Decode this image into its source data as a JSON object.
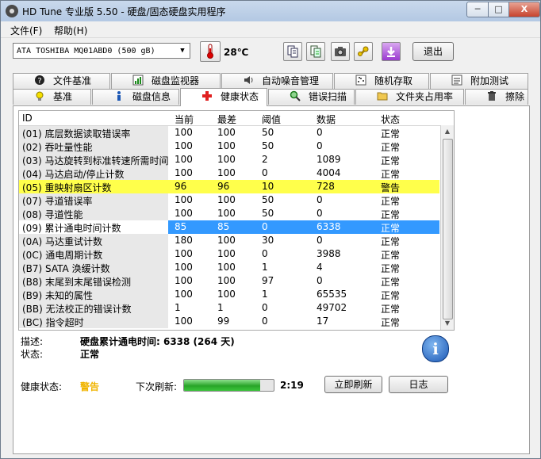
{
  "window": {
    "title": "HD Tune 专业版 5.50 - 硬盘/固态硬盘实用程序",
    "min_glyph": "─",
    "max_glyph": "□",
    "close_glyph": "X"
  },
  "menu": [
    {
      "label": "文件(F)"
    },
    {
      "label": "帮助(H)"
    }
  ],
  "toolbar": {
    "drive": "ATA    TOSHIBA MQ01ABD0 (500 gB)",
    "temperature": "28℃",
    "exit_label": "退出",
    "icons": [
      "copy-icon",
      "copy-info-icon",
      "camera-icon",
      "settings-icon",
      "download-icon"
    ]
  },
  "tabs_top": [
    {
      "label": "文件基准",
      "icon": "file-benchmark-icon"
    },
    {
      "label": "磁盘监视器",
      "icon": "disk-monitor-icon"
    },
    {
      "label": "自动噪音管理",
      "icon": "speaker-icon"
    },
    {
      "label": "随机存取",
      "icon": "random-access-icon"
    },
    {
      "label": "附加测试",
      "icon": "extra-tests-icon"
    }
  ],
  "tabs_bottom": [
    {
      "label": "基准",
      "icon": "benchmark-icon"
    },
    {
      "label": "磁盘信息",
      "icon": "info-small-icon"
    },
    {
      "label": "健康状态",
      "icon": "health-cross-icon",
      "active": true
    },
    {
      "label": "错误扫描",
      "icon": "magnifier-icon"
    },
    {
      "label": "文件夹占用率",
      "icon": "folder-icon"
    },
    {
      "label": "擦除",
      "icon": "trash-icon"
    }
  ],
  "table": {
    "headers": [
      "ID",
      "当前",
      "最差",
      "阈值",
      "数据",
      "状态"
    ],
    "rows": [
      {
        "id": "(01) 底层数据读取错误率",
        "cur": "100",
        "worst": "100",
        "thresh": "50",
        "data": "0",
        "status": "正常"
      },
      {
        "id": "(02) 吞吐量性能",
        "cur": "100",
        "worst": "100",
        "thresh": "50",
        "data": "0",
        "status": "正常"
      },
      {
        "id": "(03) 马达旋转到标准转速所需时间",
        "cur": "100",
        "worst": "100",
        "thresh": "2",
        "data": "1089",
        "status": "正常"
      },
      {
        "id": "(04) 马达启动/停止计数",
        "cur": "100",
        "worst": "100",
        "thresh": "0",
        "data": "4004",
        "status": "正常"
      },
      {
        "id": "(05) 重映射扇区计数",
        "cur": "96",
        "worst": "96",
        "thresh": "10",
        "data": "728",
        "status": "警告",
        "state": "warn"
      },
      {
        "id": "(07) 寻道错误率",
        "cur": "100",
        "worst": "100",
        "thresh": "50",
        "data": "0",
        "status": "正常"
      },
      {
        "id": "(08) 寻道性能",
        "cur": "100",
        "worst": "100",
        "thresh": "50",
        "data": "0",
        "status": "正常"
      },
      {
        "id": "(09) 累计通电时间计数",
        "cur": "85",
        "worst": "85",
        "thresh": "0",
        "data": "6338",
        "status": "正常",
        "state": "sel"
      },
      {
        "id": "(0A) 马达重试计数",
        "cur": "180",
        "worst": "100",
        "thresh": "30",
        "data": "0",
        "status": "正常"
      },
      {
        "id": "(0C) 通电周期计数",
        "cur": "100",
        "worst": "100",
        "thresh": "0",
        "data": "3988",
        "status": "正常"
      },
      {
        "id": "(B7) SATA 涣缓计数",
        "cur": "100",
        "worst": "100",
        "thresh": "1",
        "data": "4",
        "status": "正常"
      },
      {
        "id": "(B8) 末尾到末尾错误检测",
        "cur": "100",
        "worst": "100",
        "thresh": "97",
        "data": "0",
        "status": "正常"
      },
      {
        "id": "(B9) 未知的属性",
        "cur": "100",
        "worst": "100",
        "thresh": "1",
        "data": "65535",
        "status": "正常"
      },
      {
        "id": "(BB) 无法校正的错误计数",
        "cur": "1",
        "worst": "1",
        "thresh": "0",
        "data": "49702",
        "status": "正常"
      },
      {
        "id": "(BC) 指令超时",
        "cur": "100",
        "worst": "99",
        "thresh": "0",
        "data": "17",
        "status": "正常"
      }
    ]
  },
  "details": {
    "desc_label": "描述:",
    "desc_value": "硬盘累计通电时间: 6338 (264 天)",
    "status_label": "状态:",
    "status_value": "正常"
  },
  "footer": {
    "health_label": "健康状态:",
    "health_value": "警告",
    "refresh_label": "下次刷新:",
    "refresh_progress": 0.85,
    "refresh_time": "2:19",
    "refresh_button": "立即刷新",
    "log_button": "日志"
  },
  "colors": {
    "warn_row": "#ffff4b",
    "selected_row": "#3399ff",
    "warn_text": "#f0b400",
    "progress_green": "#28a428"
  }
}
